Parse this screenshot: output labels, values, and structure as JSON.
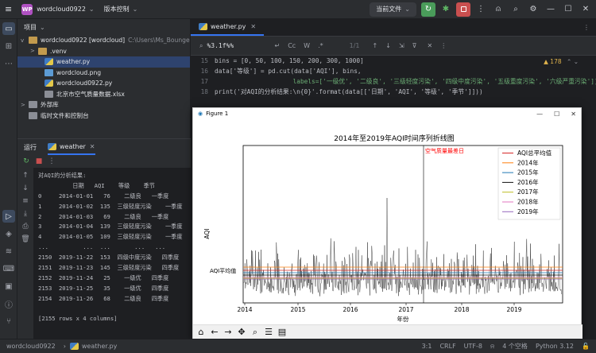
{
  "titlebar": {
    "project_badge": "WP",
    "project_name": "wordcloud0922",
    "vcs_label": "版本控制",
    "run_config": "当前文件"
  },
  "project_panel": {
    "header": "项目",
    "items": [
      {
        "label": "wordcloud0922 [wordcloud]",
        "hint": "C:\\Users\\Ms_Bounge",
        "icon": "folder-icon",
        "arrow": "v"
      },
      {
        "label": ".venv",
        "hint": "",
        "icon": "folder-icon",
        "arrow": ">"
      },
      {
        "label": "weather.py",
        "hint": "",
        "icon": "python-file-icon",
        "arrow": ""
      },
      {
        "label": "wordcloud.png",
        "hint": "",
        "icon": "image-file-icon",
        "arrow": ""
      },
      {
        "label": "wordcloud0922.py",
        "hint": "",
        "icon": "python-file-icon",
        "arrow": ""
      },
      {
        "label": "北京市空气质量数据.xlsx",
        "hint": "",
        "icon": "excel-file-icon",
        "arrow": ""
      },
      {
        "label": "外部库",
        "hint": "",
        "icon": "library-icon",
        "arrow": ">"
      },
      {
        "label": "临时文件和控制台",
        "hint": "",
        "icon": "scratch-icon",
        "arrow": ""
      }
    ]
  },
  "run_panel": {
    "header": "运行",
    "tab": "weather",
    "console_lines": [
      "对AQI的分析结果:",
      "          日期   AQI    等级    季节",
      "0     2014-01-01   76    二级良   一季度",
      "1     2014-01-02  135  三级轻度污染    一季度",
      "2     2014-01-03   69    二级良   一季度",
      "3     2014-01-04  139  三级轻度污染    一季度",
      "4     2014-01-05  109  三级轻度污染    一季度",
      "...          ...  ...       ...   ...",
      "2150  2019-11-22  153  四级中度污染   四季度",
      "2151  2019-11-23  145  三级轻度污染   四季度",
      "2152  2019-11-24   25    一级优   四季度",
      "2153  2019-11-25   35    一级优   四季度",
      "2154  2019-11-26   68    二级良   四季度",
      "",
      "[2155 rows x 4 columns]"
    ]
  },
  "editor": {
    "tab": "weather.py",
    "find_query": "%3.1f%%",
    "find_count": "1/1",
    "inspection_warnings": "▲ 178",
    "code_lines": [
      {
        "num": "15",
        "text": "bins = [0, 50, 100, 150, 200, 300, 1000]"
      },
      {
        "num": "16",
        "text": "data['等级'] = pd.cut(data['AQI'], bins,"
      },
      {
        "num": "17",
        "text": "                     labels=['一级优', '二级良', '三级轻度污染', '四级中度污染', '五级重度污染', '六级严重污染'])"
      },
      {
        "num": "18",
        "text": "print('对AQI的分析结果:\\n{0}'.format(data[['日期', 'AQI', '等级', '季节']]))"
      }
    ]
  },
  "figure": {
    "window_title": "Figure 1",
    "toolbar_icons": [
      "home-icon",
      "back-icon",
      "forward-icon",
      "pan-icon",
      "zoom-icon",
      "configure-icon",
      "save-icon"
    ]
  },
  "chart_data": {
    "type": "line",
    "title": "2014年至2019年AQI时间序列折线图",
    "xlabel": "年份",
    "ylabel": "AQI",
    "x_ticks": [
      "2014",
      "2015",
      "2016",
      "2017",
      "2018",
      "2019"
    ],
    "annotations": [
      {
        "text": "空气质量最差日",
        "color": "#ff0000"
      },
      {
        "text": "AQI平均值",
        "color": "#000000"
      }
    ],
    "legend_position": "upper-right",
    "series": [
      {
        "name": "AQI总平均值",
        "color": "#d62728"
      },
      {
        "name": "2014年",
        "color": "#ff7f0e"
      },
      {
        "name": "2015年",
        "color": "#1f77b4"
      },
      {
        "name": "2016年",
        "color": "#111111"
      },
      {
        "name": "2017年",
        "color": "#bcbd22"
      },
      {
        "name": "2018年",
        "color": "#e377c2"
      },
      {
        "name": "2019年",
        "color": "#9467bd"
      }
    ]
  },
  "statusbar": {
    "project": "wordcloud0922",
    "file": "weather.py",
    "position": "3:1",
    "line_sep": "CRLF",
    "encoding": "UTF-8",
    "indent": "4 个空格",
    "interpreter": "Python 3.12"
  }
}
